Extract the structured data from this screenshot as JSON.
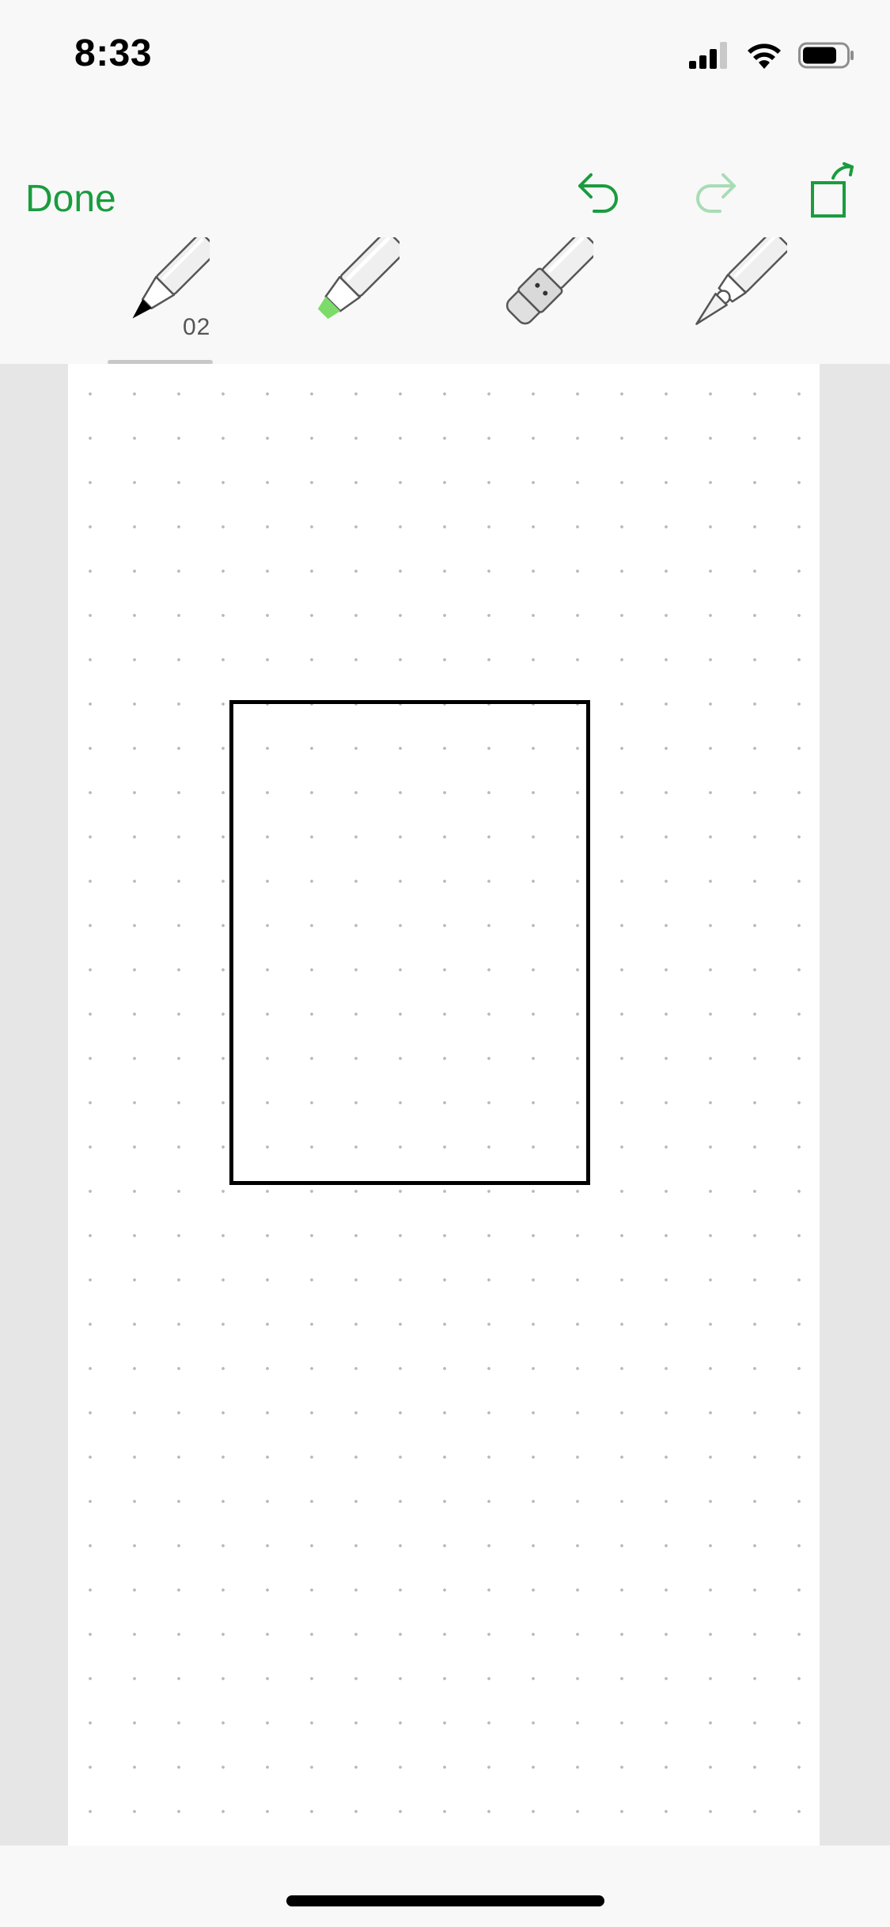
{
  "status_bar": {
    "time": "8:33",
    "icons": [
      "cellular-signal-icon",
      "wifi-icon",
      "battery-icon"
    ]
  },
  "toolbar": {
    "done_label": "Done",
    "undo_icon": "undo-icon",
    "redo_icon": "redo-icon",
    "resize_icon": "page-resize-icon",
    "accent_color": "#1a9c3e"
  },
  "tools": {
    "items": [
      {
        "name": "pen",
        "icon": "pen-icon",
        "size_label": "02",
        "selected": true
      },
      {
        "name": "highlighter",
        "icon": "highlighter-icon",
        "color": "#7ddb6a"
      },
      {
        "name": "eraser",
        "icon": "eraser-icon"
      },
      {
        "name": "cutter",
        "icon": "cutter-icon"
      }
    ]
  },
  "canvas": {
    "background": "dot-grid",
    "shapes": [
      "rectangle"
    ]
  }
}
